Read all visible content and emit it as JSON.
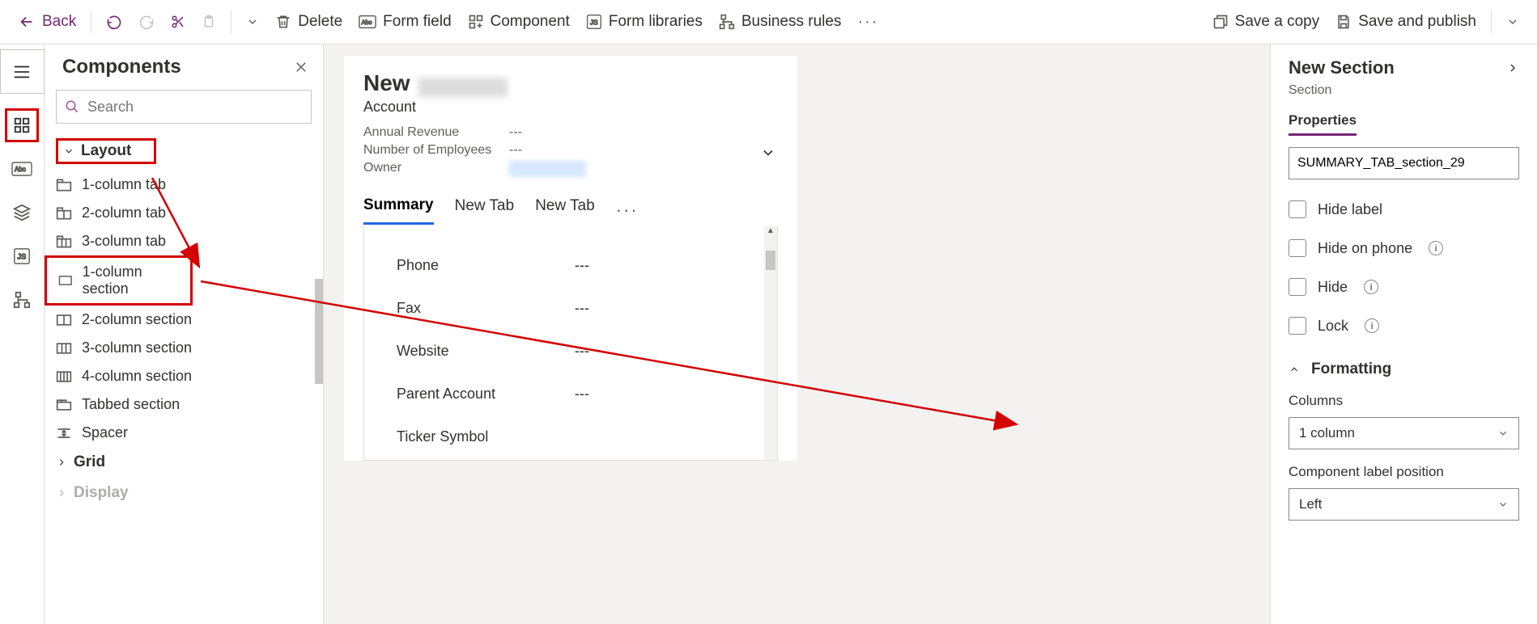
{
  "toolbar": {
    "back": "Back",
    "delete": "Delete",
    "form_field": "Form field",
    "component": "Component",
    "form_libraries": "Form libraries",
    "business_rules": "Business rules",
    "save_copy": "Save a copy",
    "save_publish": "Save and publish"
  },
  "panel": {
    "title": "Components",
    "search_placeholder": "Search",
    "layout_label": "Layout",
    "grid_label": "Grid",
    "display_label": "Display",
    "items": [
      "1-column tab",
      "2-column tab",
      "3-column tab",
      "1-column section",
      "2-column section",
      "3-column section",
      "4-column section",
      "Tabbed section",
      "Spacer"
    ]
  },
  "form": {
    "new": "New",
    "entity": "Account",
    "meta": {
      "annual_revenue": {
        "label": "Annual Revenue",
        "value": "---"
      },
      "employees": {
        "label": "Number of Employees",
        "value": "---"
      },
      "owner": {
        "label": "Owner"
      }
    },
    "tabs": [
      "Summary",
      "New Tab",
      "New Tab"
    ],
    "fields": [
      {
        "label": "Phone",
        "value": "---"
      },
      {
        "label": "Fax",
        "value": "---"
      },
      {
        "label": "Website",
        "value": "---"
      },
      {
        "label": "Parent Account",
        "value": "---"
      },
      {
        "label": "Ticker Symbol",
        "value": ""
      }
    ]
  },
  "props": {
    "title": "New Section",
    "sub": "Section",
    "tab": "Properties",
    "name_value": "SUMMARY_TAB_section_29",
    "hide_label": "Hide label",
    "hide_phone": "Hide on phone",
    "hide": "Hide",
    "lock": "Lock",
    "formatting": "Formatting",
    "columns_label": "Columns",
    "columns_value": "1 column",
    "label_pos_label": "Component label position",
    "label_pos_value": "Left"
  }
}
